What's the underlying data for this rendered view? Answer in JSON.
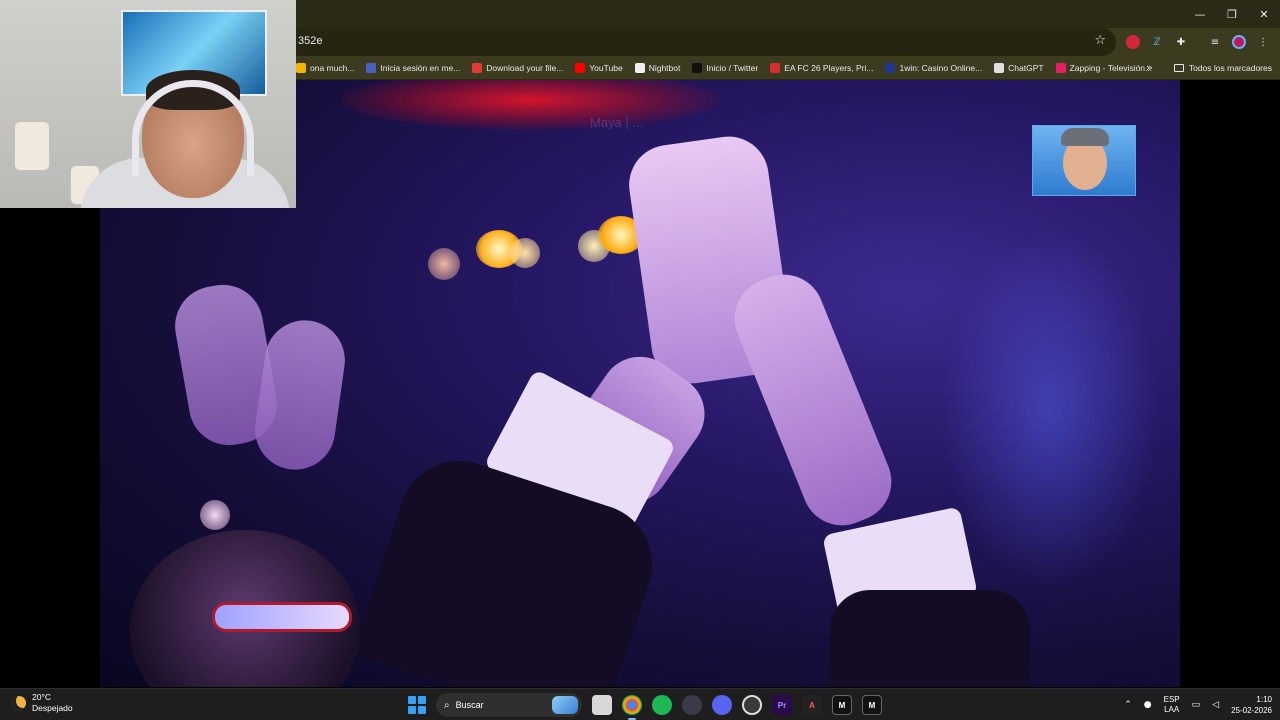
{
  "window": {
    "minimize": "—",
    "maximize": "❐",
    "close": "✕"
  },
  "omnibox": {
    "url_fragment": "352e"
  },
  "bookmarks": [
    {
      "label": "ona much...",
      "color": "#f4b400"
    },
    {
      "label": "Inicia sesión en me...",
      "color": "#4a5fc1"
    },
    {
      "label": "Download your file...",
      "color": "#e53935"
    },
    {
      "label": "YouTube",
      "color": "#ff0000"
    },
    {
      "label": "Nightbot",
      "color": "#f1f1f1"
    },
    {
      "label": "Inicio / Twitter",
      "color": "#111111"
    },
    {
      "label": "EA FC 26 Players, Pri...",
      "color": "#d32f2f"
    },
    {
      "label": "1win: Casino Online...",
      "color": "#1e3a8a"
    },
    {
      "label": "ChatGPT",
      "color": "#e0e0e0"
    },
    {
      "label": "Zapping - Televisión...",
      "color": "#e91e63"
    }
  ],
  "bookmarks_more": "»",
  "all_bookmarks": "Todos los marcadores",
  "video": {
    "watermark": "Maya | ..."
  },
  "taskbar": {
    "temperature": "20°C",
    "condition": "Despejado",
    "search_label": "Buscar",
    "lang_top": "ESP",
    "lang_bottom": "LAA",
    "time": "1:10",
    "date": "25-02-2026"
  },
  "colors": {
    "accent": "#8ab4f8",
    "titlebar": "#2b2a17",
    "toolbar": "#3c3a1f"
  }
}
